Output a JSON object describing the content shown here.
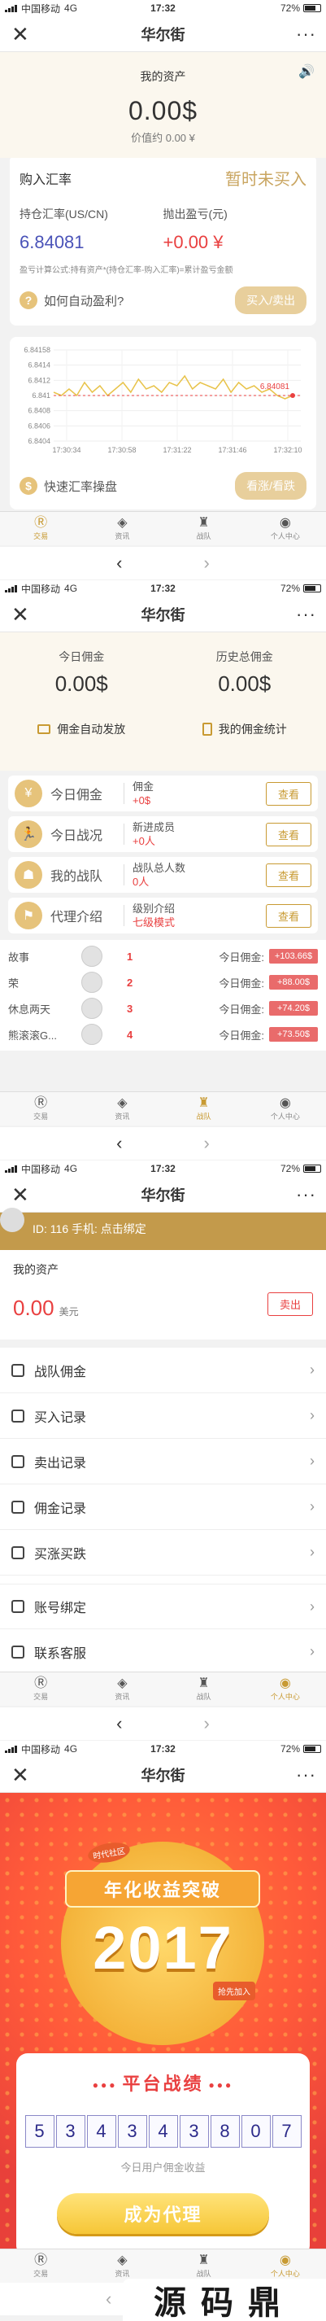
{
  "status": {
    "carrier": "中国移动",
    "net": "4G",
    "time": "17:32",
    "battery": "72%"
  },
  "app_title": "华尔街",
  "nav_more": "···",
  "tabs": [
    {
      "label": "交易"
    },
    {
      "label": "资讯"
    },
    {
      "label": "战队"
    },
    {
      "label": "个人中心"
    }
  ],
  "bottom_nav": {
    "back": "‹",
    "forward": "›"
  },
  "screen1": {
    "asset_label": "我的资产",
    "asset_value": "0.00$",
    "asset_sub": "价值约 0.00 ¥",
    "buy_title": "购入汇率",
    "buy_status": "暂时未买入",
    "hold_rate_label": "持仓汇率(US/CN)",
    "hold_rate_value": "6.84081",
    "pl_label": "抛出盈亏(元)",
    "pl_value": "+0.00 ¥",
    "formula": "盈亏计算公式:持有资产*(持仓汇率-购入汇率)=累计盈亏金额",
    "help_text": "如何自动盈利?",
    "buy_btn": "买入/卖出",
    "chart_help": "快速汇率操盘",
    "chart_btn": "看涨/看跌",
    "last_label": "6.84081"
  },
  "chart_data": {
    "type": "line",
    "x": [
      "17:30:34",
      "17:30:58",
      "17:31:22",
      "17:31:46",
      "17:32:10"
    ],
    "ylim": [
      6.8394,
      6.8422
    ],
    "y_ticks": [
      "6.84158",
      "6.8414",
      "6.8412",
      "6.841",
      "6.8408",
      "6.8406",
      "6.8404"
    ],
    "x_ticks": [
      "17:30:34",
      "17:30:58",
      "17:31:22",
      "17:31:46",
      "17:32:10"
    ],
    "values": [
      6.8409,
      6.8408,
      6.841,
      6.8408,
      6.8412,
      6.8409,
      6.8411,
      6.8408,
      6.841,
      6.8412,
      6.8409,
      6.8413,
      6.841,
      6.8411,
      6.8409,
      6.8412,
      6.8411,
      6.8414,
      6.841,
      6.8412,
      6.8411,
      6.841,
      6.8413,
      6.8409,
      6.8412,
      6.841,
      6.8411,
      6.8409,
      6.841,
      6.8408,
      6.8407,
      6.8408
    ]
  },
  "screen2": {
    "today_label": "今日佣金",
    "today_value": "0.00$",
    "history_label": "历史总佣金",
    "history_value": "0.00$",
    "auto_pay": "佣金自动发放",
    "my_stats": "我的佣金统计",
    "rows": [
      {
        "name": "今日佣金",
        "l1": "佣金",
        "l2": "+0$",
        "btn": "查看"
      },
      {
        "name": "今日战况",
        "l1": "新进成员",
        "l2": "+0人",
        "btn": "查看"
      },
      {
        "name": "我的战队",
        "l1": "战队总人数",
        "l2": "0人",
        "btn": "查看"
      },
      {
        "name": "代理介绍",
        "l1": "级别介绍",
        "l2": "七级模式",
        "btn": "查看"
      }
    ],
    "ranking": [
      {
        "name": "故事",
        "no": "1",
        "label": "今日佣金:",
        "amount": "+103.66$"
      },
      {
        "name": "荣",
        "no": "2",
        "label": "今日佣金:",
        "amount": "+88.00$"
      },
      {
        "name": "休息两天",
        "no": "3",
        "label": "今日佣金:",
        "amount": "+74.20$"
      },
      {
        "name": "熊滚滚G...",
        "no": "4",
        "label": "今日佣金:",
        "amount": "+73.50$"
      }
    ]
  },
  "screen3": {
    "user_line": "ID: 116 手机: 点击绑定",
    "asset_label": "我的资产",
    "asset_value": "0.00",
    "asset_unit": "美元",
    "sell_btn": "卖出",
    "menu": [
      "战队佣金",
      "买入记录",
      "卖出记录",
      "佣金记录",
      "买涨买跌",
      "账号绑定",
      "联系客服"
    ]
  },
  "screen4": {
    "ribbon": "年化收益突破",
    "year": "2017",
    "tag1": "时代社区",
    "tag2": "抢先加入",
    "panel_title": "平台战绩",
    "digits": [
      "5",
      "3",
      "4",
      "3",
      "4",
      "3",
      "8",
      "0",
      "7"
    ],
    "panel_note": "今日用户佣金收益",
    "cta": "成为代理",
    "watermark": "源码鼎"
  },
  "colors": {
    "gold": "#c89a32",
    "red": "#e94040",
    "blue": "#4a53b8"
  }
}
